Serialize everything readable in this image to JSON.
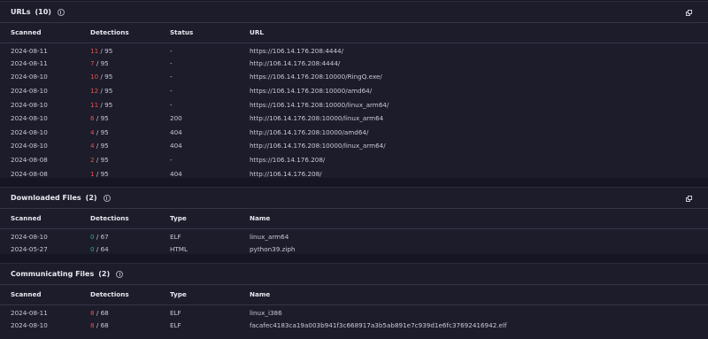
{
  "urls": {
    "title": "URLs",
    "count": "(10)",
    "columns": [
      "Scanned",
      "Detections",
      "Status",
      "URL"
    ],
    "rows": [
      {
        "scanned": "2024-08-11",
        "det": "11",
        "total": " / 95",
        "status": "-",
        "url": "https://106.14.176.208:4444/",
        "det_color": "red"
      },
      {
        "scanned": "2024-08-11",
        "det": "7",
        "total": " / 95",
        "status": "-",
        "url": "http://106.14.176.208:4444/",
        "det_color": "red"
      },
      {
        "scanned": "2024-08-10",
        "det": "10",
        "total": " / 95",
        "status": "-",
        "url": "https://106.14.176.208:10000/RingQ.exe/",
        "det_color": "red"
      },
      {
        "scanned": "2024-08-10",
        "det": "12",
        "total": " / 95",
        "status": "-",
        "url": "https://106.14.176.208:10000/amd64/",
        "det_color": "red"
      },
      {
        "scanned": "2024-08-10",
        "det": "11",
        "total": " / 95",
        "status": "-",
        "url": "https://106.14.176.208:10000/linux_arm64/",
        "det_color": "red"
      },
      {
        "scanned": "2024-08-10",
        "det": "6",
        "total": " / 95",
        "status": "200",
        "url": "http://106.14.176.208:10000/linux_arm64",
        "det_color": "red"
      },
      {
        "scanned": "2024-08-10",
        "det": "4",
        "total": " / 95",
        "status": "404",
        "url": "http://106.14.176.208:10000/amd64/",
        "det_color": "red"
      },
      {
        "scanned": "2024-08-10",
        "det": "4",
        "total": " / 95",
        "status": "404",
        "url": "http://106.14.176.208:10000/linux_arm64/",
        "det_color": "red"
      },
      {
        "scanned": "2024-08-08",
        "det": "2",
        "total": " / 95",
        "status": "-",
        "url": "https://106.14.176.208/",
        "det_color": "red"
      },
      {
        "scanned": "2024-08-08",
        "det": "1",
        "total": " / 95",
        "status": "404",
        "url": "http://106.14.176.208/",
        "det_color": "red"
      }
    ]
  },
  "downloaded": {
    "title": "Downloaded Files",
    "count": "(2)",
    "columns": [
      "Scanned",
      "Detections",
      "Type",
      "Name"
    ],
    "rows": [
      {
        "scanned": "2024-08-10",
        "det": "0",
        "total": " / 67",
        "type": "ELF",
        "name": "linux_arm64",
        "det_color": "green"
      },
      {
        "scanned": "2024-05-27",
        "det": "0",
        "total": " / 64",
        "type": "HTML",
        "name": "python39.ziph",
        "det_color": "green"
      }
    ]
  },
  "communicating": {
    "title": "Communicating Files",
    "count": "(2)",
    "columns": [
      "Scanned",
      "Detections",
      "Type",
      "Name"
    ],
    "rows": [
      {
        "scanned": "2024-08-11",
        "det": "8",
        "total": " / 68",
        "type": "ELF",
        "name": "linux_i386",
        "det_color": "red"
      },
      {
        "scanned": "2024-08-10",
        "det": "8",
        "total": " / 68",
        "type": "ELF",
        "name": "facafec4183ca19a003b941f3c668917a3b5ab891e7c939d1e6fc37692416942.elf",
        "det_color": "red"
      }
    ]
  },
  "colors": {
    "background": "#151523",
    "panel": "#1c1c2b",
    "malicious": "#e8534e",
    "clean": "#27b093"
  },
  "icons": {
    "info": "info-circle-icon",
    "copy": "copy-icon"
  }
}
